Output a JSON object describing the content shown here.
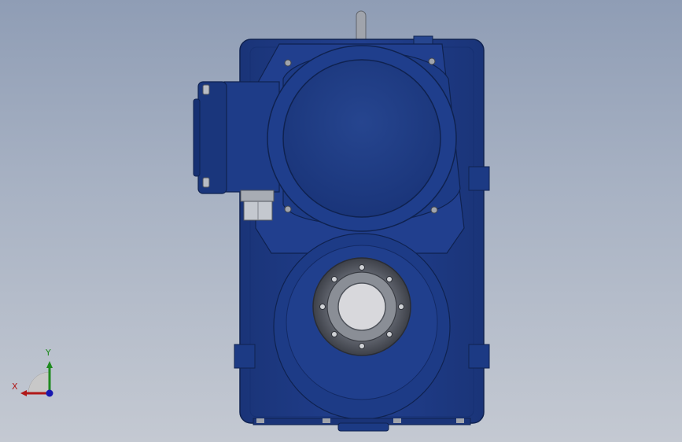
{
  "viewport": {
    "background_top": "#8f9db5",
    "background_bottom": "#c4c9d2"
  },
  "model": {
    "body_color": "#1f3e8c",
    "body_dark": "#142d6a",
    "body_light": "#3558b0",
    "flange_color": "#505560",
    "bore_color": "#d2d2d6"
  },
  "triad": {
    "x_label": "X",
    "y_label": "Y",
    "x_color": "#b01818",
    "y_color": "#1f8a1f",
    "z_color": "#1818b0"
  }
}
